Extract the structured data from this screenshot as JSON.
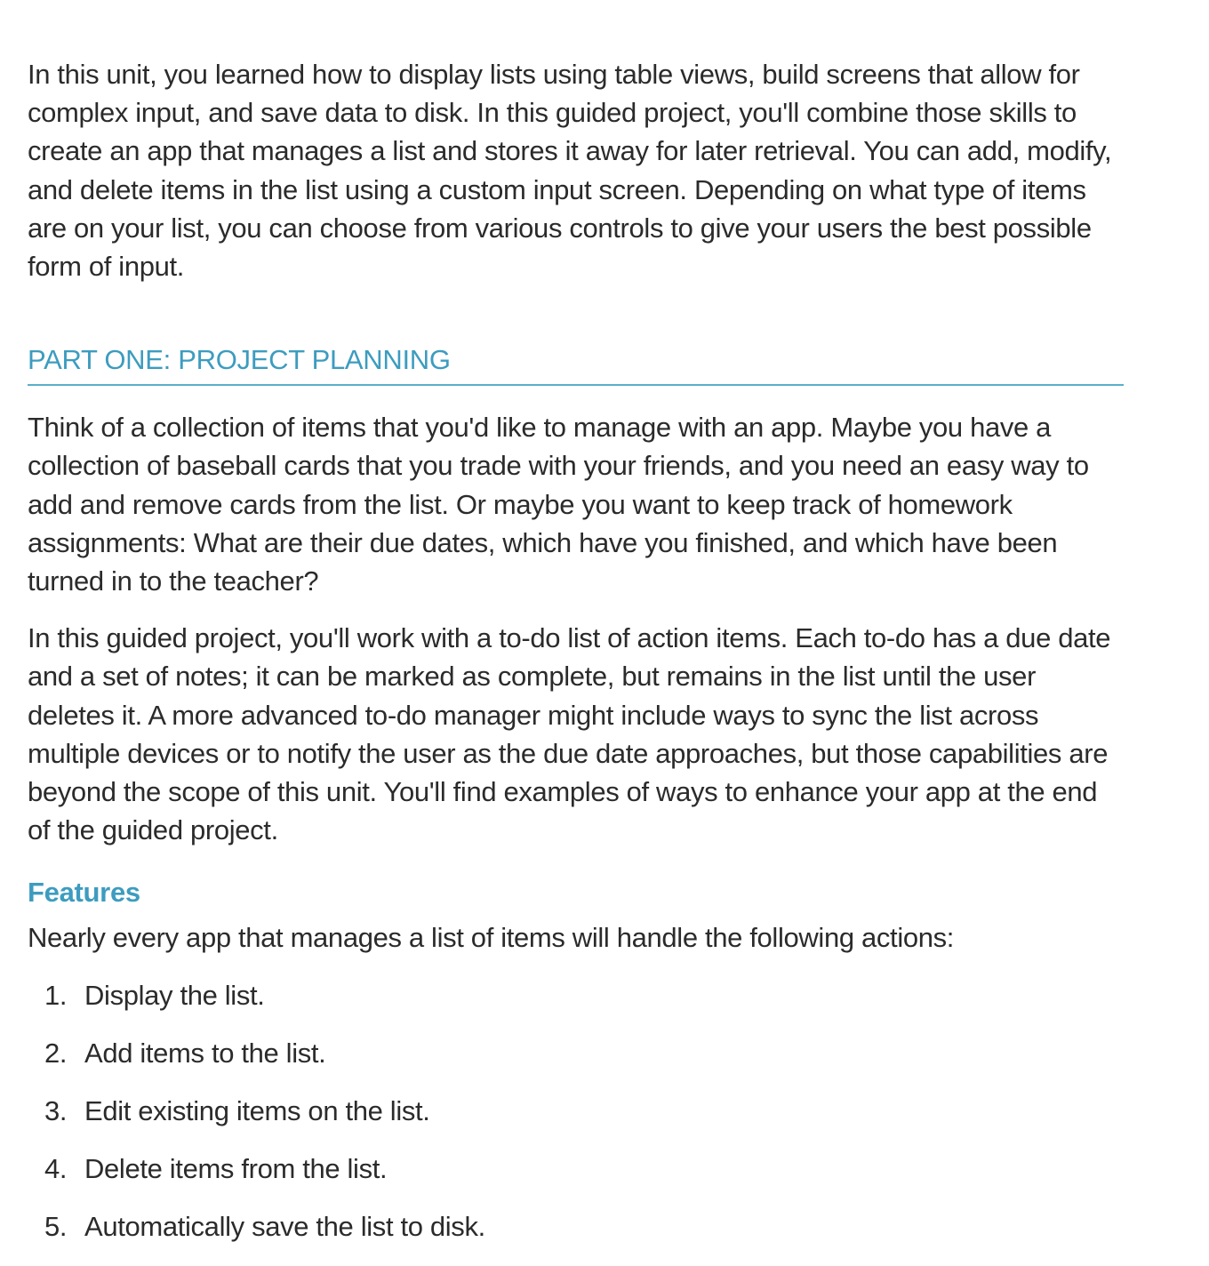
{
  "intro": "In this unit, you learned how to display lists using table views, build screens that allow for complex input, and save data to disk. In this guided project, you'll combine those skills to create an app that manages a list and stores it away for later retrieval. You can add, modify, and delete items in the list using a custom input screen. Depending on what type of items are on your list, you can choose from various controls to give your users the best possible form of input.",
  "section": {
    "heading": "PART ONE: PROJECT PLANNING",
    "para1": "Think of a collection of items that you'd like to manage with an app. Maybe you have a collection of baseball cards that you trade with your friends, and you need an easy way to add and remove cards from the list. Or maybe you want to keep track of homework assignments: What are their due dates, which have you finished, and which have been turned in to the teacher?",
    "para2": "In this guided project, you'll work with a to-do list of action items. Each to-do has a due date and a set of notes; it can be marked as complete, but remains in the list until the user deletes it. A more advanced to-do manager might include ways to sync the list across multiple devices or to notify the user as the due date approaches, but those capabilities are beyond the scope of this unit. You'll find examples of ways to enhance your app at the end of the guided project."
  },
  "features": {
    "heading": "Features",
    "intro": "Nearly every app that manages a list of items will handle the following actions:",
    "items": [
      {
        "num": "1.",
        "text": "Display the list."
      },
      {
        "num": "2.",
        "text": "Add items to the list."
      },
      {
        "num": "3.",
        "text": "Edit existing items on the list."
      },
      {
        "num": "4.",
        "text": "Delete items from the list."
      },
      {
        "num": "5.",
        "text": "Automatically save the list to disk."
      }
    ]
  },
  "colors": {
    "accent": "#3d9cbf",
    "text": "#2b2b2b",
    "rule": "#5aaecb"
  }
}
